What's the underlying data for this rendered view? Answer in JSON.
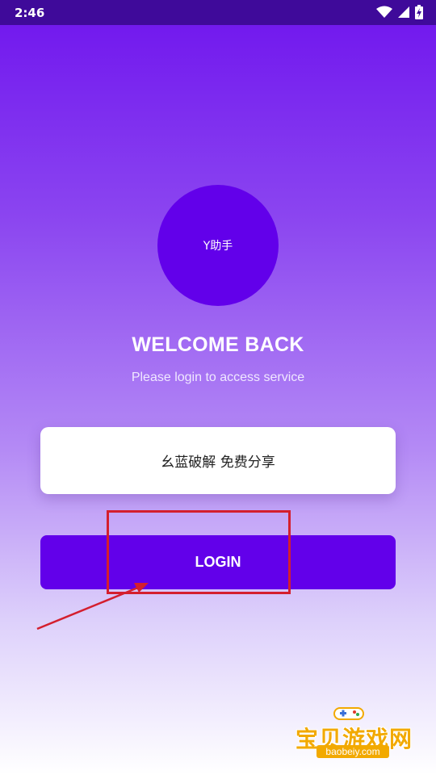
{
  "status_bar": {
    "time": "2:46",
    "icons": [
      "wifi-icon",
      "signal-icon",
      "battery-icon"
    ]
  },
  "logo": {
    "text": "Y助手"
  },
  "welcome": {
    "title": "WELCOME BACK",
    "subtitle": "Please login to access service"
  },
  "notice": {
    "text": "幺蓝破解 免费分享"
  },
  "login": {
    "label": "LOGIN"
  },
  "watermark": {
    "text": "宝贝游戏网",
    "url": "baobeiy.com"
  },
  "colors": {
    "status_bar": "#3f0a9a",
    "accent": "#6200ea",
    "annotation": "#d41f2e",
    "watermark": "#f2a900"
  }
}
